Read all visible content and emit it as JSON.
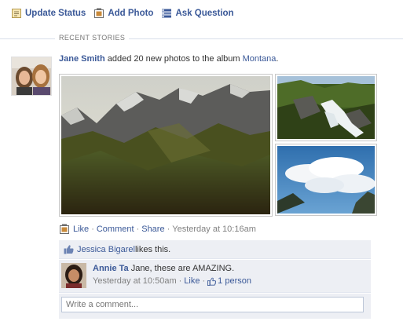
{
  "composer": {
    "items": [
      {
        "label": "Update Status",
        "icon": "status-icon"
      },
      {
        "label": "Add Photo",
        "icon": "photo-icon"
      },
      {
        "label": "Ask Question",
        "icon": "question-icon"
      }
    ]
  },
  "feed": {
    "section_label": "RECENT STORIES"
  },
  "story": {
    "author": "Jane Smith",
    "action_text": " added 20 new photos to the album ",
    "album": "Montana",
    "album_suffix": ".",
    "photos": [
      {
        "name": "mountain-photo",
        "icon": "photo"
      },
      {
        "name": "waterfall-photo",
        "icon": "photo"
      },
      {
        "name": "sky-photo",
        "icon": "photo"
      }
    ],
    "actions": {
      "like": "Like",
      "comment": "Comment",
      "share": "Share",
      "separator": "·",
      "timestamp": "Yesterday at 10:16am"
    }
  },
  "ufi": {
    "likes": {
      "liker": "Jessica Bigarel",
      "text": " likes this."
    },
    "comments": [
      {
        "author": "Annie Ta",
        "text": " Jane, these are AMAZING.",
        "timestamp": "Yesterday at 10:50am",
        "like_label": "Like",
        "like_count": "1 person"
      }
    ],
    "comment_placeholder": "Write a comment..."
  },
  "colors": {
    "link": "#3b5998",
    "ufi_background": "#edeff4",
    "muted_text": "#808080"
  }
}
